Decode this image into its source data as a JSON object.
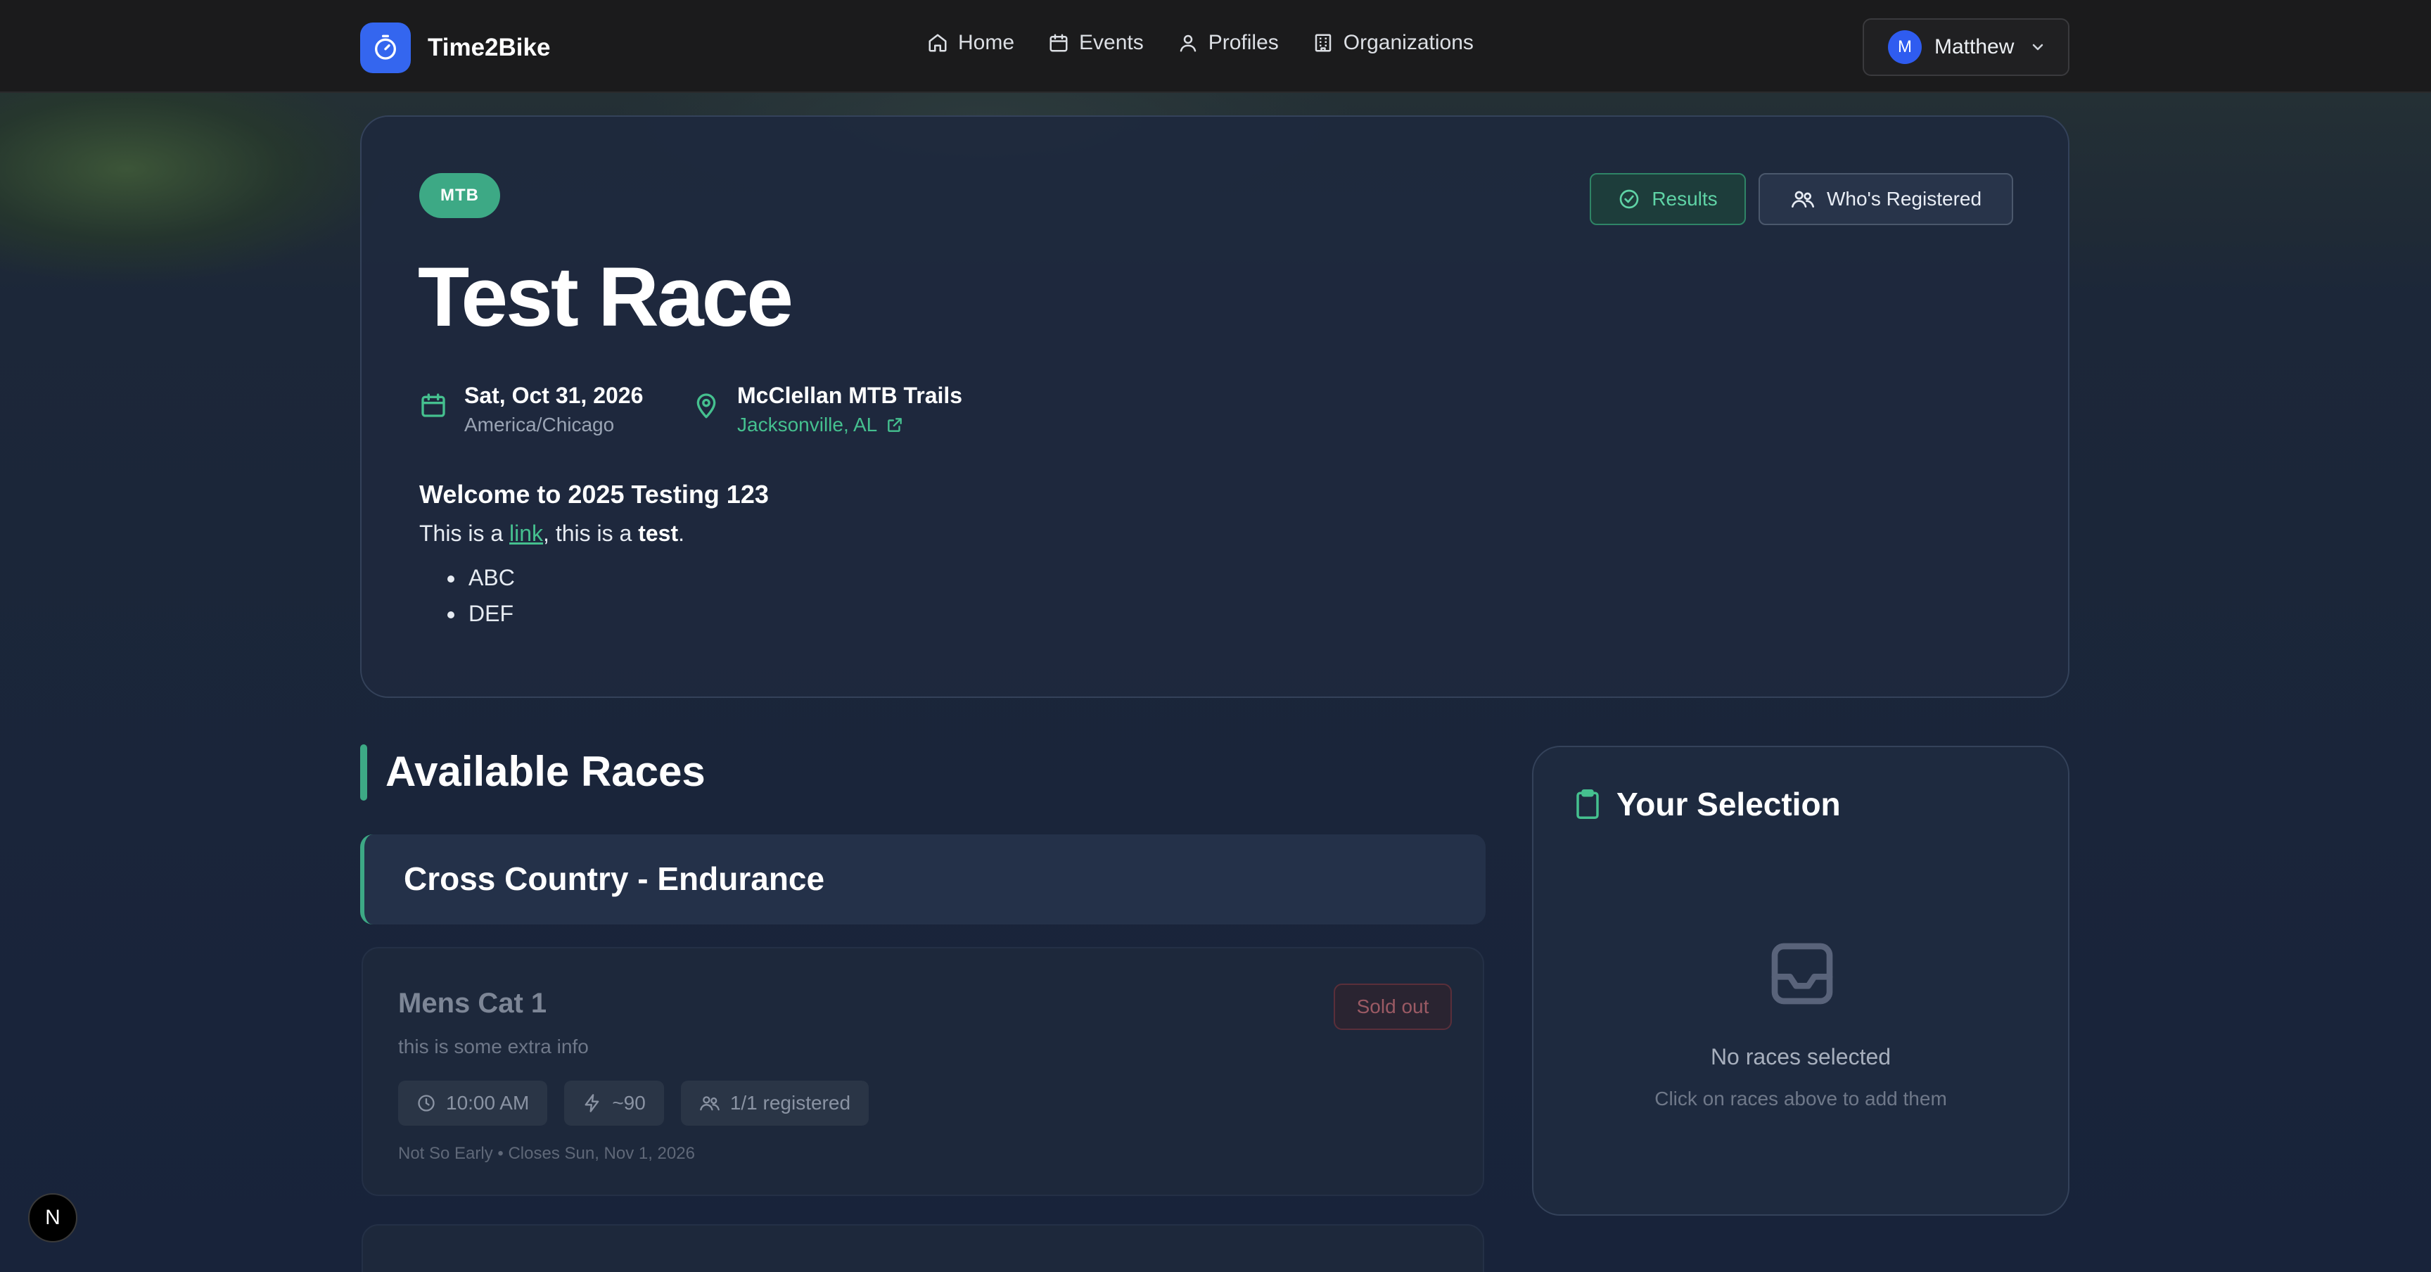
{
  "nav": {
    "brand": "Time2Bike",
    "links": [
      {
        "label": "Home",
        "icon": "home-icon"
      },
      {
        "label": "Events",
        "icon": "calendar-icon"
      },
      {
        "label": "Profiles",
        "icon": "user-icon"
      },
      {
        "label": "Organizations",
        "icon": "building-icon"
      }
    ],
    "user": {
      "initial": "M",
      "name": "Matthew"
    }
  },
  "event": {
    "badge": "MTB",
    "title": "Test Race",
    "date": "Sat, Oct 31, 2026",
    "timezone": "America/Chicago",
    "venue": "McClellan MTB Trails",
    "city": "Jacksonville, AL",
    "buttons": {
      "results": "Results",
      "registered": "Who's Registered"
    },
    "description": {
      "heading": "Welcome to 2025 Testing 123",
      "text_before_link": "This is a ",
      "link_text": "link",
      "text_middle": ", this is a ",
      "bold_text": "test",
      "text_after": ".",
      "bullets": [
        "ABC",
        "DEF"
      ]
    }
  },
  "races": {
    "section_title": "Available Races",
    "category": "Cross Country - Endurance",
    "items": [
      {
        "name": "Mens Cat 1",
        "info": "this is some extra info",
        "status": "Sold out",
        "time": "10:00 AM",
        "duration": "~90",
        "registered": "1/1 registered",
        "footer": "Not So Early • Closes Sun, Nov 1, 2026"
      }
    ]
  },
  "selection": {
    "title": "Your Selection",
    "empty_title": "No races selected",
    "empty_subtitle": "Click on races above to add them"
  },
  "dev_badge": "N",
  "colors": {
    "accent_green": "#3da985",
    "brand_blue": "#3466ef",
    "background": "#1c2739"
  }
}
